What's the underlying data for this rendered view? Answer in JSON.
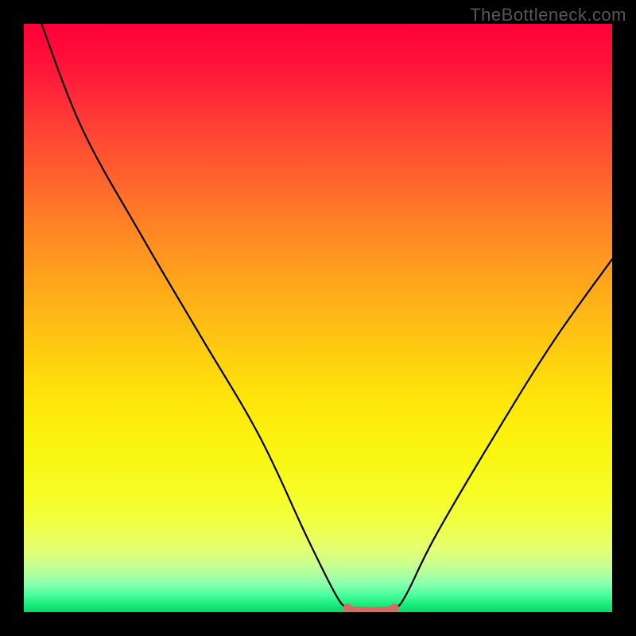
{
  "watermark": "TheBottleneck.com",
  "chart_data": {
    "type": "line",
    "title": "",
    "xlabel": "",
    "ylabel": "",
    "xlim": [
      0,
      100
    ],
    "ylim": [
      0,
      100
    ],
    "series": [
      {
        "name": "curve",
        "x": [
          3,
          10,
          20,
          30,
          40,
          48,
          53,
          55,
          57,
          60,
          63,
          65,
          70,
          80,
          90,
          100
        ],
        "y": [
          100,
          82,
          64,
          47,
          30,
          13,
          3,
          0.7,
          0.3,
          0.3,
          0.7,
          3,
          13,
          30,
          46,
          60
        ]
      },
      {
        "name": "highlight",
        "x": [
          55,
          56,
          58,
          60,
          62,
          63
        ],
        "y": [
          0.7,
          0.4,
          0.3,
          0.3,
          0.4,
          0.7
        ]
      }
    ],
    "gradient_stops": [
      {
        "pos": 0.0,
        "color": "#ff0038"
      },
      {
        "pos": 0.5,
        "color": "#ffce10"
      },
      {
        "pos": 0.8,
        "color": "#f0ff45"
      },
      {
        "pos": 1.0,
        "color": "#0fd26a"
      }
    ],
    "highlight_color": "#d56a66"
  }
}
